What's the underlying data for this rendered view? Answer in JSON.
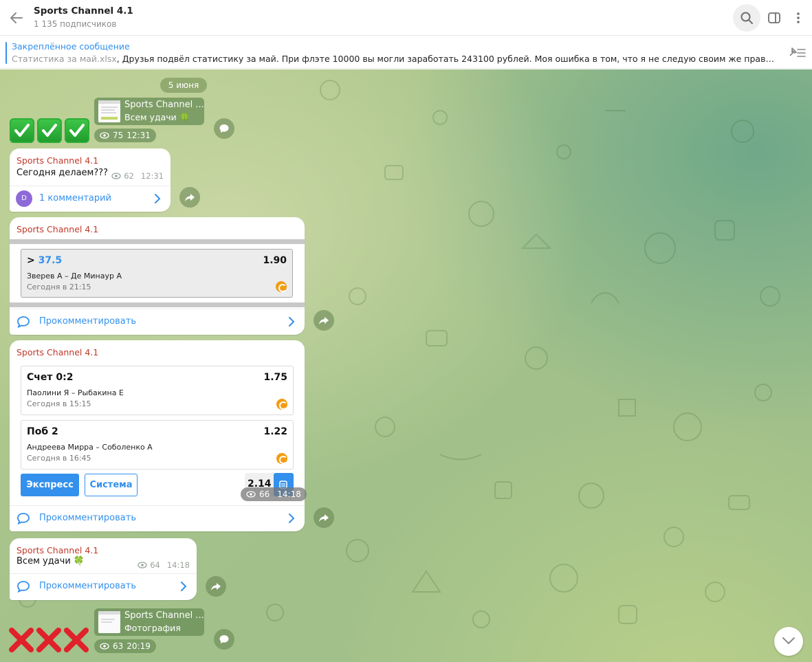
{
  "header": {
    "title": "Sports Channel 4.1",
    "subtitle": "1 135 подписчиков"
  },
  "pinned": {
    "label": "Закреплённое сообщение",
    "file": "Статистика за май.xlsx",
    "text": ", Друзья подвёл статистику за май. При флэте 10000 вы могли заработать 243100 рублей. Моя ошибка в том, что я не следую своим же правилам, забыва..."
  },
  "chat": {
    "date": "5 июня",
    "messages": [
      {
        "id": "m1",
        "reply_name": "Sports Channel ...",
        "reply_sub": "Всем удачи 🍀",
        "views": "75",
        "time": "12:31"
      },
      {
        "id": "m2",
        "sender": "Sports Channel 4.1",
        "text": "Сегодня делаем???",
        "views": "62",
        "time": "12:31",
        "avatar_letter": "D",
        "comments_label": "1 комментарий"
      },
      {
        "id": "m3",
        "sender": "Sports Channel 4.1",
        "bet": {
          "market_prefix": ">",
          "market_value": "37.5",
          "odds": "1.90",
          "match": "Зверев А – Де Минаур А",
          "time": "Сегодня в 21:15"
        },
        "comment_label": "Прокомментировать"
      },
      {
        "id": "m4",
        "sender": "Sports Channel 4.1",
        "bets": [
          {
            "market": "Счет 0:2",
            "odds": "1.75",
            "match": "Паолини Я – Рыбакина Е",
            "time": "Сегодня в 15:15"
          },
          {
            "market": "Поб 2",
            "odds": "1.22",
            "match": "Андреева Мирра – Соболенко А",
            "time": "Сегодня в 16:45"
          }
        ],
        "express_label": "Экспресс",
        "system_label": "Система",
        "total_odds": "2.14",
        "views": "66",
        "time": "14:18",
        "comment_label": "Прокомментировать"
      },
      {
        "id": "m5",
        "sender": "Sports Channel 4.1",
        "text": "Всем удачи 🍀",
        "views": "64",
        "time": "14:18",
        "comment_label": "Прокомментировать"
      },
      {
        "id": "m6",
        "reply_name": "Sports Channel ...",
        "reply_sub": "Фотография",
        "views": "63",
        "time": "20:19"
      }
    ]
  },
  "colors": {
    "accent": "#3390ec",
    "sender": "#c0392b",
    "check": "#2cad36",
    "cross": "#e0202a"
  }
}
